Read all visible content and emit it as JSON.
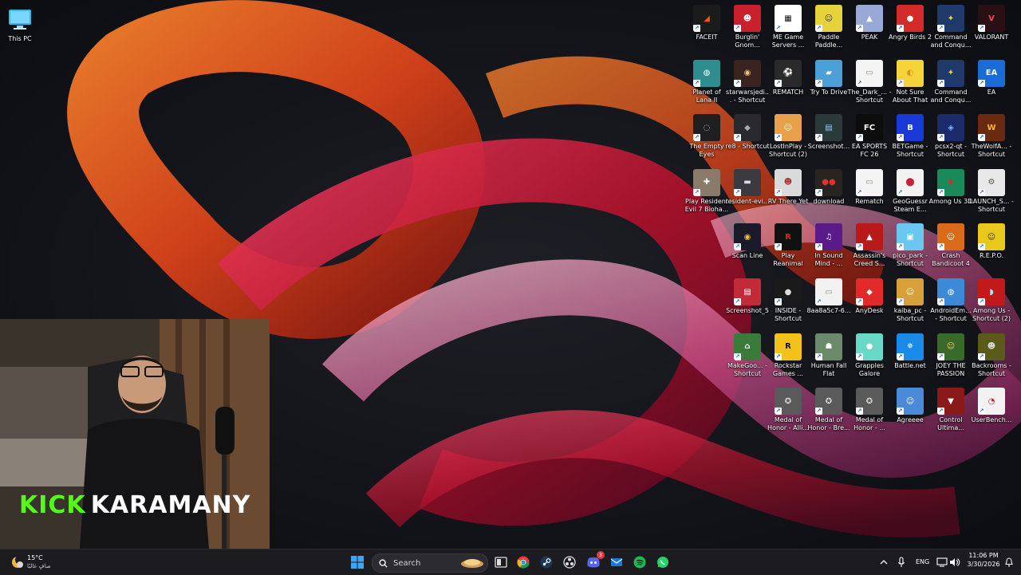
{
  "desktop": {
    "this_pc": {
      "label": "This PC",
      "icon": "monitor-icon"
    },
    "icons": [
      {
        "label": "FACEIT",
        "color": "#1b1b1b",
        "glyph": "◢",
        "fg": "#ff5500"
      },
      {
        "label": "Burglin' Gnom...",
        "color": "#c9202d",
        "glyph": "☻",
        "fg": "#fff"
      },
      {
        "label": "ME Game Servers ...",
        "color": "#ffffff",
        "glyph": "▦",
        "fg": "#111"
      },
      {
        "label": "Paddle Paddle...",
        "color": "#e6d23a",
        "glyph": "☺",
        "fg": "#333"
      },
      {
        "label": "PEAK",
        "color": "#9aa8d8",
        "glyph": "▲",
        "fg": "#fff"
      },
      {
        "label": "Angry Birds 2",
        "color": "#d32a2a",
        "glyph": "●",
        "fg": "#fff"
      },
      {
        "label": "Command and Conqu...",
        "color": "#1f3a6a",
        "glyph": "✦",
        "fg": "#ffd23a"
      },
      {
        "label": "VALORANT",
        "color": "#2a0f14",
        "glyph": "V",
        "fg": "#ff4655"
      },
      {
        "label": "Planet of Lana II",
        "color": "#2f8d8f",
        "glyph": "◍",
        "fg": "#fff"
      },
      {
        "label": "starwarsjedi... - Shortcut",
        "color": "#3a2420",
        "glyph": "◉",
        "fg": "#f2c37a"
      },
      {
        "label": "REMATCH",
        "color": "#2a2a2a",
        "glyph": "⚽",
        "fg": "#fff"
      },
      {
        "label": "Try To Drive",
        "color": "#4ca0d8",
        "glyph": "▰",
        "fg": "#fff"
      },
      {
        "label": "The_Dark_... - Shortcut",
        "color": "#f4f4f4",
        "glyph": "▭",
        "fg": "#888"
      },
      {
        "label": "Not Sure About That",
        "color": "#f5d33a",
        "glyph": "◐",
        "fg": "#e08a1a"
      },
      {
        "label": "Command and Conqu...",
        "color": "#1f3a6a",
        "glyph": "✦",
        "fg": "#ffd23a"
      },
      {
        "label": "EA",
        "color": "#1a6ad8",
        "glyph": "EA",
        "fg": "#fff"
      },
      {
        "label": "The Empty Eyes",
        "color": "#1f1f22",
        "glyph": "◌",
        "fg": "#ccc"
      },
      {
        "label": "re8 - Shortcut",
        "color": "#2a2a2e",
        "glyph": "◆",
        "fg": "#aaa"
      },
      {
        "label": "LostInPlay - Shortcut (2)",
        "color": "#e8a04a",
        "glyph": "☺",
        "fg": "#fff"
      },
      {
        "label": "Screenshot...",
        "color": "#2a3a3a",
        "glyph": "▤",
        "fg": "#9cf"
      },
      {
        "label": "EA SPORTS FC 26",
        "color": "#0d0d0d",
        "glyph": "FC",
        "fg": "#fff"
      },
      {
        "label": "BETGame - Shortcut",
        "color": "#1a3ad8",
        "glyph": "B",
        "fg": "#fff"
      },
      {
        "label": "pcsx2-qt - Shortcut",
        "color": "#1a2a6a",
        "glyph": "◈",
        "fg": "#7ab0ff"
      },
      {
        "label": "TheWolfA... - Shortcut",
        "color": "#6a2a10",
        "glyph": "W",
        "fg": "#ffb43a"
      },
      {
        "label": "Play Resident Evil 7 Bioha...",
        "color": "#8a7a6a",
        "glyph": "✚",
        "fg": "#fff"
      },
      {
        "label": "resident-evi...",
        "color": "#3a3a40",
        "glyph": "▬",
        "fg": "#ddd"
      },
      {
        "label": "RV There Yet",
        "color": "#dadada",
        "glyph": "☻",
        "fg": "#a33"
      },
      {
        "label": "download",
        "color": "#2a2420",
        "glyph": "●●",
        "fg": "#d33"
      },
      {
        "label": "Rematch",
        "color": "#f4f4f4",
        "glyph": "▭",
        "fg": "#888"
      },
      {
        "label": "GeoGuessr Steam E...",
        "color": "#f2f2f2",
        "glyph": "⬤",
        "fg": "#c2233a"
      },
      {
        "label": "Among Us 3D",
        "color": "#1a8a5a",
        "glyph": "◗",
        "fg": "#e22"
      },
      {
        "label": "LAUNCH_S... - Shortcut",
        "color": "#e8e8e8",
        "glyph": "⚙",
        "fg": "#555"
      },
      {
        "label": "",
        "color": "transparent",
        "glyph": "",
        "fg": "#fff"
      },
      {
        "label": "Scan Line",
        "color": "#1a1a2a",
        "glyph": "◉",
        "fg": "#f2c23a"
      },
      {
        "label": "Play Reanimal",
        "color": "#111111",
        "glyph": "R",
        "fg": "#d22"
      },
      {
        "label": "In Sound Mind - ...",
        "color": "#5a1a8a",
        "glyph": "♫",
        "fg": "#fff"
      },
      {
        "label": "Assassin's Creed S...",
        "color": "#b81a1a",
        "glyph": "▲",
        "fg": "#fff"
      },
      {
        "label": "pico_park - Shortcut",
        "color": "#6ac8f0",
        "glyph": "▣",
        "fg": "#fff"
      },
      {
        "label": "Crash Bandicoot 4",
        "color": "#d86a1a",
        "glyph": "☺",
        "fg": "#fff"
      },
      {
        "label": "R.E.P.O.",
        "color": "#e8c81a",
        "glyph": "☺",
        "fg": "#333"
      },
      {
        "label": "",
        "color": "transparent",
        "glyph": "",
        "fg": "#fff"
      },
      {
        "label": "Screenshot_5",
        "color": "#c22a3a",
        "glyph": "▤",
        "fg": "#fff"
      },
      {
        "label": "INSIDE - Shortcut",
        "color": "#1a1a1a",
        "glyph": "●",
        "fg": "#ddd"
      },
      {
        "label": "8aa8a5c7-6...",
        "color": "#f2f2f2",
        "glyph": "▭",
        "fg": "#888"
      },
      {
        "label": "AnyDesk",
        "color": "#e22a2a",
        "glyph": "◆",
        "fg": "#fff"
      },
      {
        "label": "kaiba_pc - Shortcut",
        "color": "#d8a03a",
        "glyph": "☺",
        "fg": "#fff"
      },
      {
        "label": "AndroidEm... - Shortcut",
        "color": "#3a8ad8",
        "glyph": "◍",
        "fg": "#fff"
      },
      {
        "label": "Among Us - Shortcut (2)",
        "color": "#c21a1a",
        "glyph": "◗",
        "fg": "#9ef"
      },
      {
        "label": "",
        "color": "transparent",
        "glyph": "",
        "fg": "#fff"
      },
      {
        "label": "MakeGoo... - Shortcut",
        "color": "#3a7a3a",
        "glyph": "⌂",
        "fg": "#fff"
      },
      {
        "label": "Rockstar Games ...",
        "color": "#f2c21a",
        "glyph": "R",
        "fg": "#111"
      },
      {
        "label": "Human Fall Flat",
        "color": "#6a8a6a",
        "glyph": "☗",
        "fg": "#fff"
      },
      {
        "label": "Grapples Galore",
        "color": "#6ad8c8",
        "glyph": "●",
        "fg": "#fff"
      },
      {
        "label": "Battle.net",
        "color": "#1a8ae8",
        "glyph": "✵",
        "fg": "#fff"
      },
      {
        "label": "JOEY THE PASSION",
        "color": "#3a6a2a",
        "glyph": "☺",
        "fg": "#ffd23a"
      },
      {
        "label": "Backrooms - Shortcut",
        "color": "#5a5a1a",
        "glyph": "☻",
        "fg": "#ddd"
      },
      {
        "label": "",
        "color": "transparent",
        "glyph": "",
        "fg": "#fff"
      },
      {
        "label": "",
        "color": "transparent",
        "glyph": "",
        "fg": "#fff"
      },
      {
        "label": "Medal of Honor - Alli...",
        "color": "#5a5a5a",
        "glyph": "✪",
        "fg": "#ddd"
      },
      {
        "label": "Medal of Honor - Bre...",
        "color": "#5a5a5a",
        "glyph": "✪",
        "fg": "#ddd"
      },
      {
        "label": "Medal of Honor - ...",
        "color": "#5a5a5a",
        "glyph": "✪",
        "fg": "#ddd"
      },
      {
        "label": "Agreeee",
        "color": "#4a8ad8",
        "glyph": "☺",
        "fg": "#fff"
      },
      {
        "label": "Control Ultima...",
        "color": "#8a1a1a",
        "glyph": "▼",
        "fg": "#fff"
      },
      {
        "label": "UserBench...",
        "color": "#f2f2f2",
        "glyph": "◔",
        "fg": "#c22"
      }
    ]
  },
  "stream_overlay": {
    "brand_left": "KICK",
    "brand_right": "KARAMANY"
  },
  "taskbar": {
    "weather_temp": "15°C",
    "weather_desc": "صافٍ غالبًا",
    "search_placeholder": "Search",
    "language": "ENG",
    "time": "11:06 PM",
    "date": "3/30/2026",
    "discord_badge": "3",
    "pinned": [
      {
        "name": "start-button",
        "icon": "windows-logo-icon"
      },
      {
        "name": "task-view-button",
        "icon": "task-view-icon"
      },
      {
        "name": "chrome-button",
        "icon": "chrome-icon"
      },
      {
        "name": "steam-button",
        "icon": "steam-icon"
      },
      {
        "name": "obs-button",
        "icon": "obs-icon"
      },
      {
        "name": "discord-button",
        "icon": "discord-icon"
      },
      {
        "name": "mail-button",
        "icon": "mail-icon"
      },
      {
        "name": "spotify-button",
        "icon": "spotify-icon"
      },
      {
        "name": "whatsapp-button",
        "icon": "whatsapp-icon"
      }
    ]
  },
  "colors": {
    "kick_green": "#53fc18",
    "taskbar_bg": "#1c1c20",
    "wallpaper_bg": "#0f1014"
  }
}
